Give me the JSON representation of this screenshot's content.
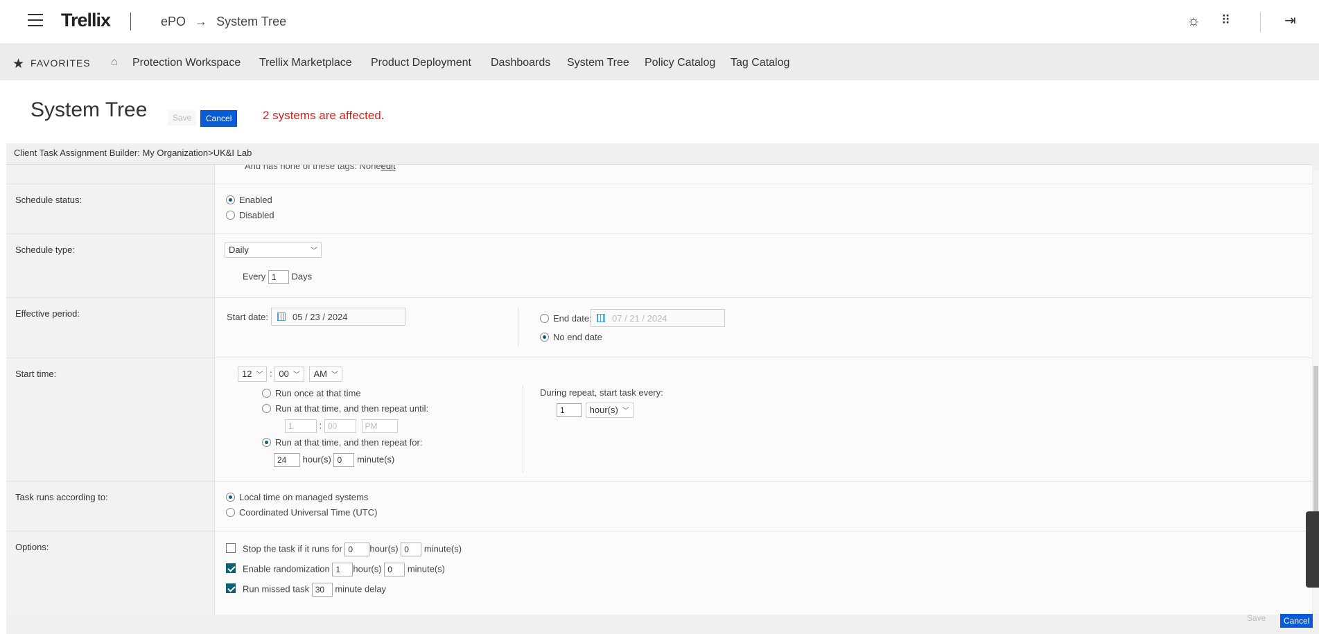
{
  "header": {
    "logo": "Trellix",
    "breadcrumb_app": "ePO",
    "breadcrumb_arrow": "→",
    "breadcrumb_page": "System Tree",
    "icons": [
      "sun-icon",
      "apps-grid-icon",
      "logout-icon"
    ]
  },
  "nav": {
    "favorites": "FAVORITES",
    "items": [
      "Protection Workspace",
      "Trellix Marketplace",
      "Product Deployment",
      "Dashboards",
      "System Tree",
      "Policy Catalog",
      "Tag Catalog"
    ]
  },
  "page": {
    "title": "System Tree",
    "save_label": "Save",
    "cancel_label": "Cancel",
    "affected_message": "2 systems are affected."
  },
  "builder": {
    "header": "Client Task Assignment Builder: My Organization>UK&I Lab",
    "tags_line": "And has none of these tags: None",
    "tags_edit": "edit",
    "schedule_status": {
      "label": "Schedule status:",
      "options": [
        "Enabled",
        "Disabled"
      ],
      "selected": "Enabled"
    },
    "schedule_type": {
      "label": "Schedule type:",
      "value": "Daily",
      "every_label": "Every",
      "every_value": "1",
      "days_label": "Days"
    },
    "effective_period": {
      "label": "Effective period:",
      "start_label": "Start date:",
      "start_value": "05 / 23 / 2024",
      "end_label": "End date:",
      "end_value": "07 / 21 / 2024",
      "no_end_label": "No end date"
    },
    "start_time": {
      "label": "Start time:",
      "hour": "12",
      "minute": "00",
      "ampm": "AM",
      "run_once": "Run once at that time",
      "repeat_until": "Run at that time, and then repeat until:",
      "until_hour": "1",
      "until_minute": "00",
      "until_ampm": "PM",
      "repeat_for": "Run at that time, and then repeat for:",
      "for_hours": "24",
      "hours_unit": "hour(s)",
      "for_minutes": "0",
      "minutes_unit": "minute(s)",
      "during_repeat": "During repeat, start task every:",
      "interval_value": "1",
      "interval_unit": "hour(s)"
    },
    "task_runs": {
      "label": "Task runs according to:",
      "local": "Local time on managed systems",
      "utc": "Coordinated Universal Time (UTC)"
    },
    "options": {
      "label": "Options:",
      "stop_label": "Stop the task if it runs for",
      "stop_hours": "0",
      "stop_minutes": "0",
      "random_label": "Enable randomization",
      "random_hours": "1",
      "random_minutes": "0",
      "missed_label": "Run missed task",
      "missed_value": "30",
      "missed_suffix": "minute delay",
      "hours_unit": "hour(s)",
      "minutes_unit": "minute(s)"
    }
  },
  "footer": {
    "save_label": "Save",
    "cancel_label": "Cancel"
  }
}
